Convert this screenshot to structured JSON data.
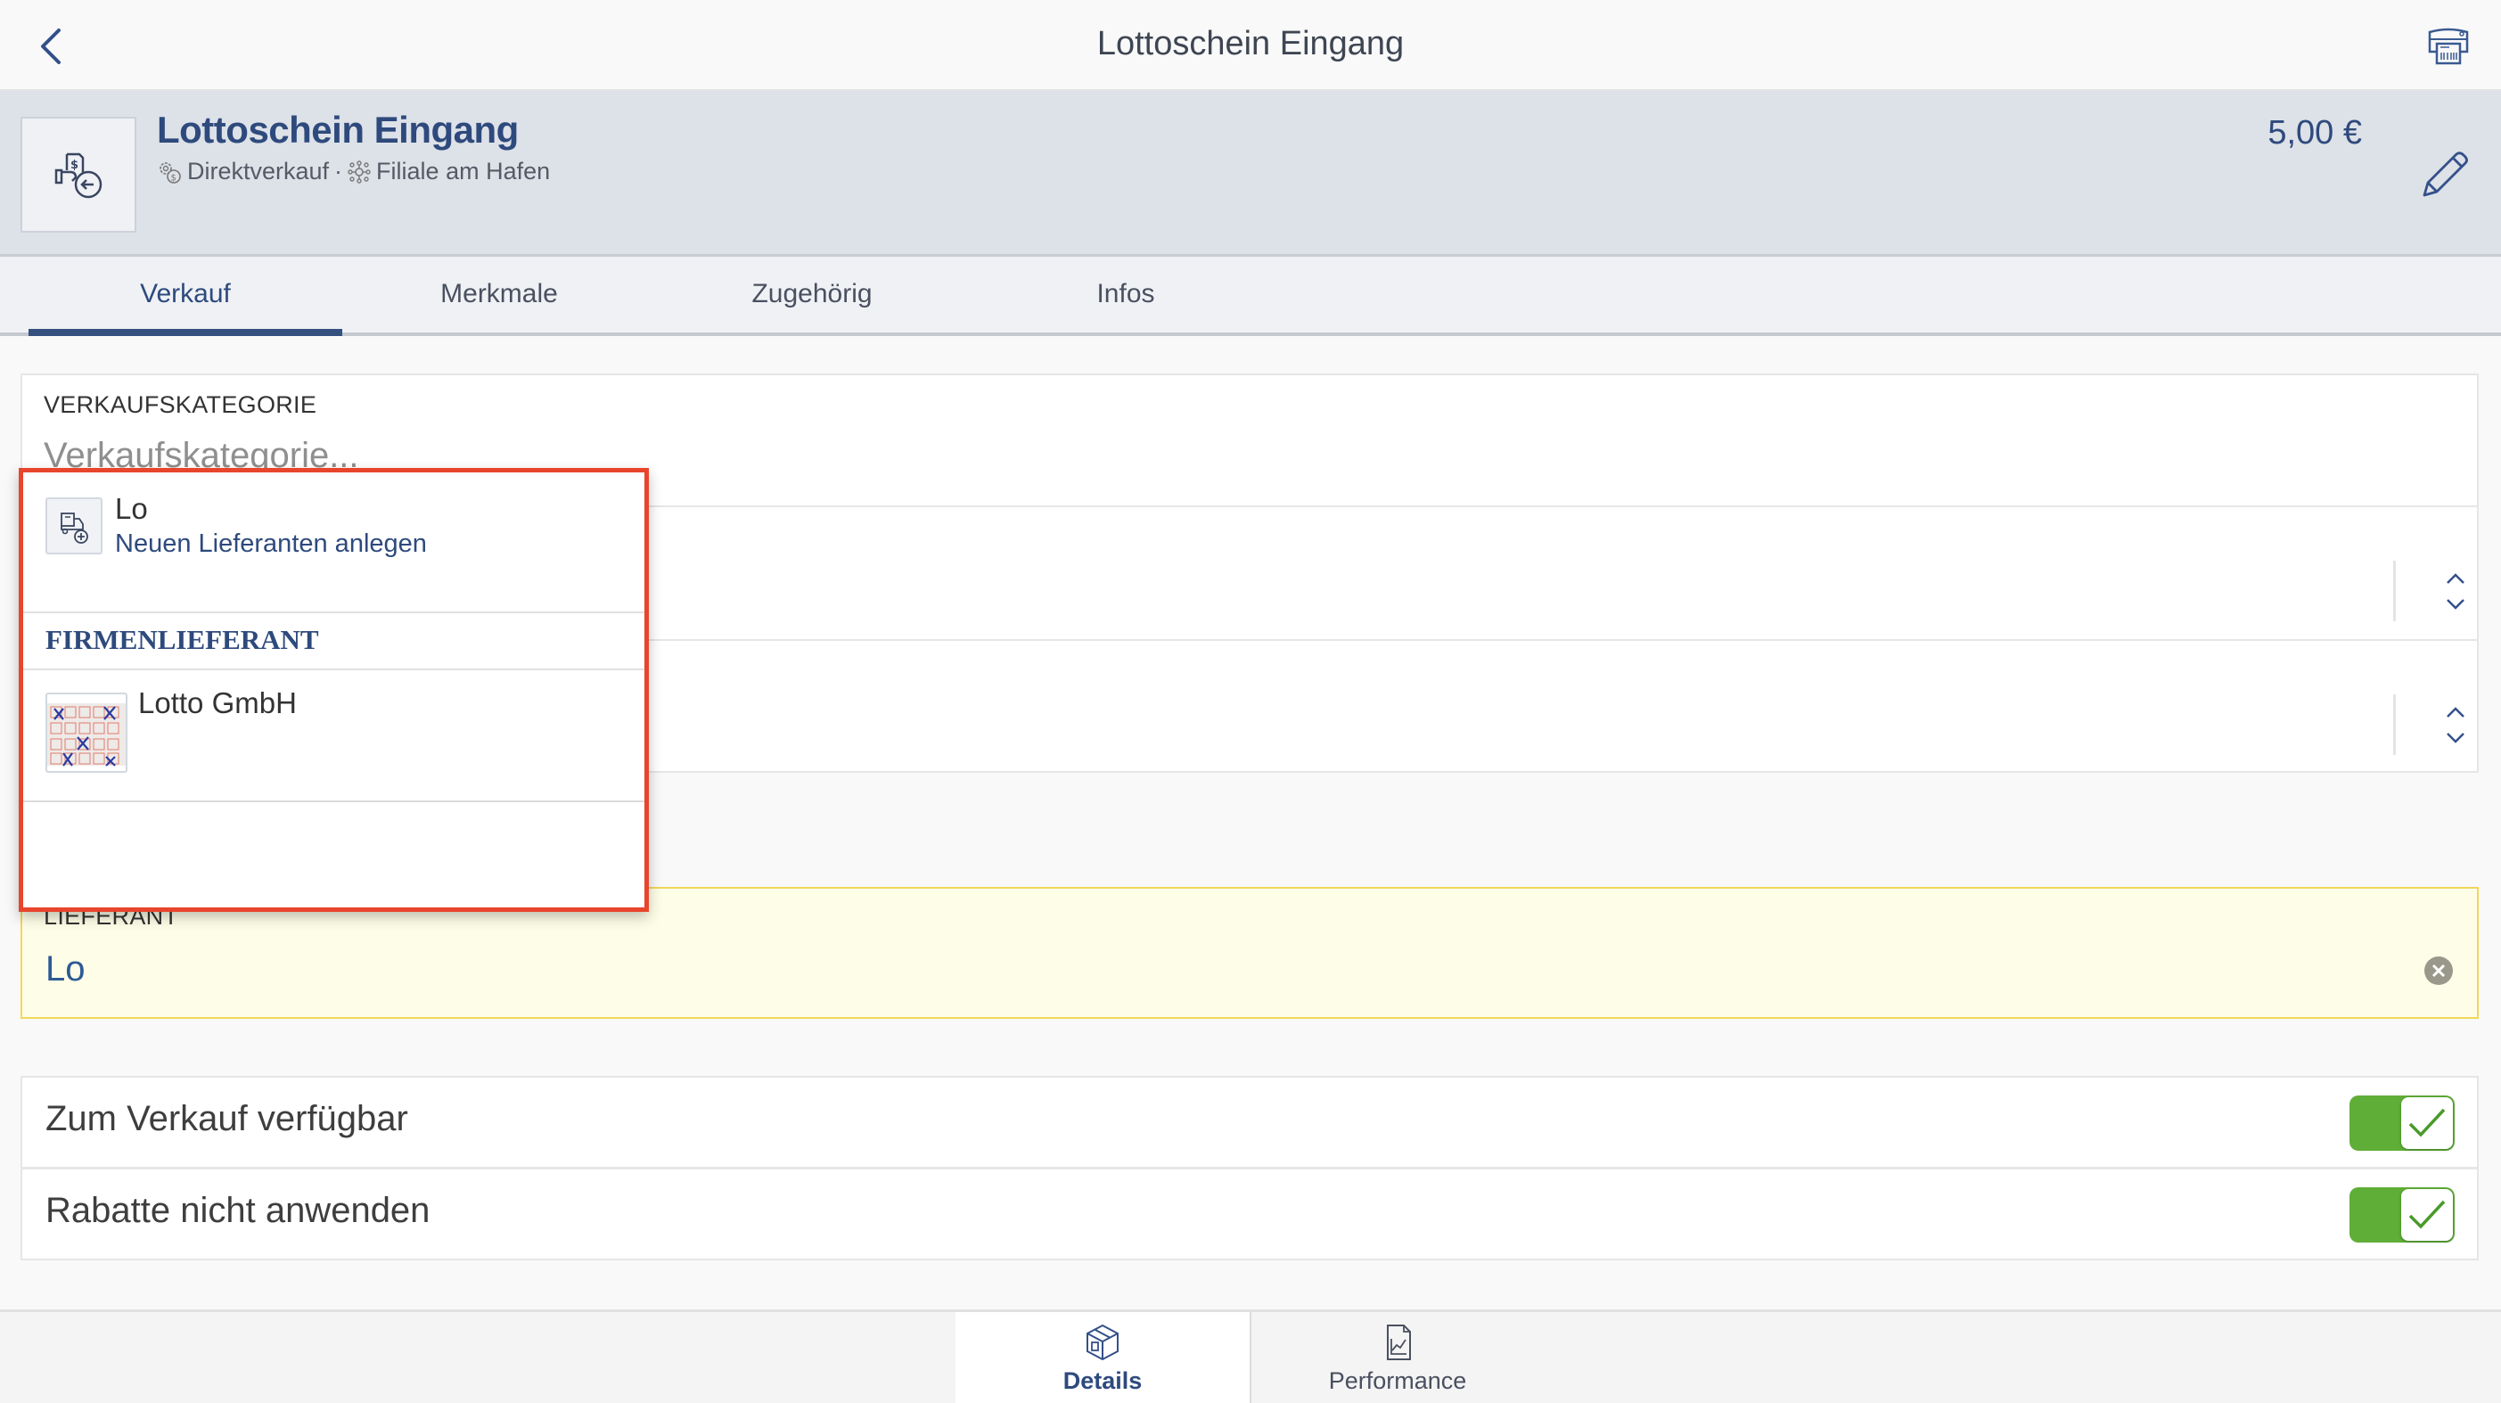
{
  "topbar": {
    "title": "Lottoschein Eingang",
    "back_icon": "chevron-left-icon",
    "printer_icon": "label-printer-icon"
  },
  "header": {
    "title": "Lottoschein Eingang",
    "type_icon": "gear-dollar-icon",
    "type": "Direktverkauf",
    "separator": "·",
    "location_icon": "network-hub-icon",
    "location": "Filiale am Hafen",
    "price": "5,00 €",
    "item_icon": "hand-document-return-icon",
    "edit_icon": "pencil-icon"
  },
  "tabs": [
    {
      "label": "Verkauf",
      "active": true
    },
    {
      "label": "Merkmale",
      "active": false
    },
    {
      "label": "Zugehörig",
      "active": false
    },
    {
      "label": "Infos",
      "active": false
    }
  ],
  "form": {
    "verkaufskategorie": {
      "label": "VERKAUFSKATEGORIE",
      "placeholder": "Verkaufskategorie..."
    },
    "lieferant": {
      "label": "LIEFERANT",
      "value": "Lo"
    },
    "toggles": [
      {
        "label": "Zum Verkauf verfügbar",
        "checked": true
      },
      {
        "label": "Rabatte nicht anwenden",
        "checked": true
      }
    ]
  },
  "dropdown": {
    "new_entry": {
      "title": "Lo",
      "subtitle": "Neuen Lieferanten anlegen",
      "icon": "truck-add-icon"
    },
    "section_label": "FIRMENLIEFERANT",
    "results": [
      {
        "name": "Lotto GmbH",
        "thumbnail": "lottery-ticket-image"
      }
    ],
    "highlight_color": "#e8452c"
  },
  "bottom_tabs": [
    {
      "label": "Details",
      "icon": "box-icon",
      "active": true
    },
    {
      "label": "Performance",
      "icon": "chart-document-icon",
      "active": false
    }
  ],
  "colors": {
    "accent": "#2e4a7d",
    "toggle_on": "#5fae37",
    "highlight_field": "#fefee8"
  }
}
